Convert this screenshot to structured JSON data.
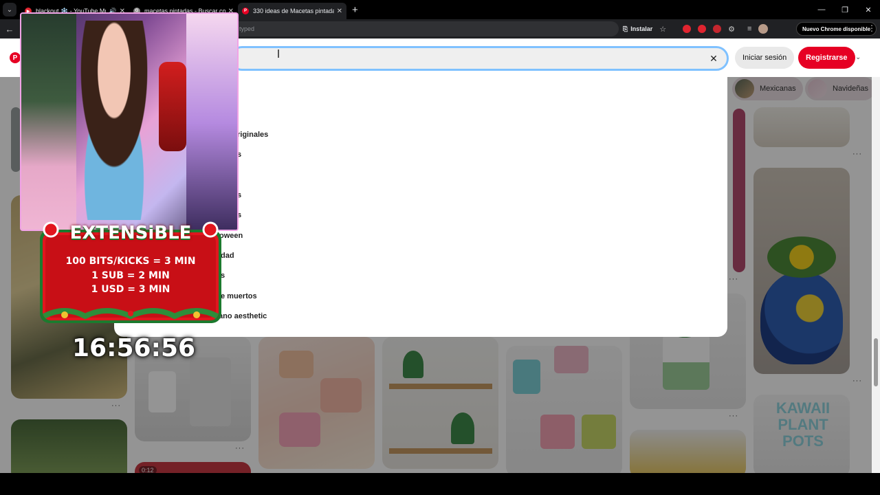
{
  "browser": {
    "tabs": [
      {
        "title": "blackout ❄️ - YouTube Mu",
        "favicon_color": "#e0242f",
        "active": false,
        "playing_audio": true
      },
      {
        "title": "macetas pintadas - Buscar con",
        "favicon_color": "#8a8a8a",
        "active": false,
        "playing_audio": false
      },
      {
        "title": "330 ideas de Macetas pintadas",
        "favicon_color": "#e60023",
        "active": true,
        "playing_audio": false
      }
    ],
    "address_suffix": "typed",
    "install_label": "Instalar",
    "update_label": "Nuevo Chrome disponible",
    "icons": {
      "back": "back-arrow-icon",
      "close": "close-icon",
      "new_tab": "plus-icon",
      "star": "star-icon"
    }
  },
  "pinterest": {
    "search_value": "",
    "login_label": "Iniciar sesión",
    "signup_label": "Registrarse",
    "brand_color": "#e60023",
    "chips": [
      {
        "label": "Mexicanas"
      },
      {
        "label": "Navideñas"
      }
    ],
    "suggestions": [
      "riginales",
      "s",
      "s",
      "s",
      "oween",
      "dad",
      "s",
      "e muertos",
      "ano aesthetic"
    ],
    "pin_badge": "0:12",
    "pin_text": "KAWAII PLANT POTS"
  },
  "stream": {
    "banner_title": "EXTENSiBLE",
    "rules": [
      "100 BITS/KICKS = 3 MIN",
      "1 SUB = 2 MIN",
      "1 USD = 3 MIN"
    ],
    "timer": "16:56:56"
  }
}
